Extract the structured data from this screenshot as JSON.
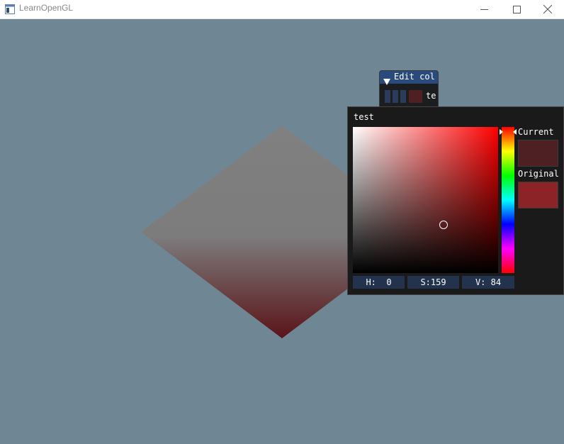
{
  "window": {
    "title": "LearnOpenGL",
    "app_icon": "app-window-icon",
    "controls": [
      "minimize-icon",
      "maximize-icon",
      "close-icon"
    ]
  },
  "scene": {
    "background_color": "#6f8794",
    "quad_colors": [
      "#808080",
      "#5a1418"
    ]
  },
  "edit_color_window": {
    "title": "Edit col",
    "collapse_icon": "triangle-down-icon",
    "label": "te",
    "color": "#4e2024"
  },
  "color_picker": {
    "title": "test",
    "current_label": "Current",
    "original_label": "Original",
    "current_color": "#4e2024",
    "original_color": "#8c2326",
    "hsv": {
      "h": "H:  0",
      "s": "S:159",
      "v": "V: 84"
    }
  }
}
